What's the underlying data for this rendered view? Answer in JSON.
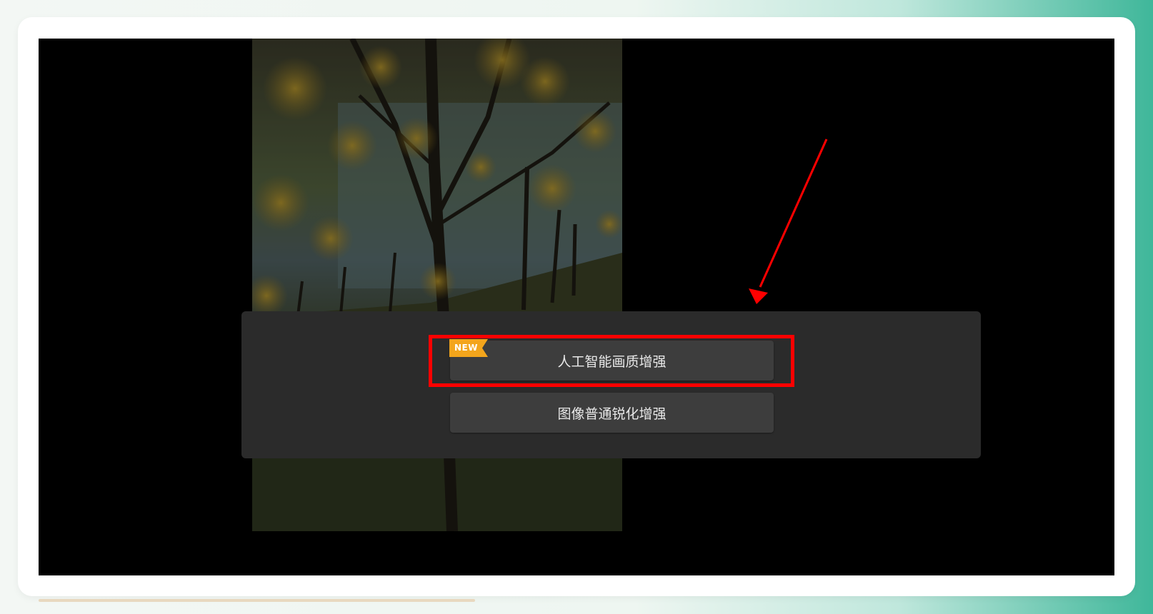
{
  "dialog": {
    "options": [
      {
        "label": "人工智能画质增强",
        "badge": "NEW"
      },
      {
        "label": "图像普通锐化增强"
      }
    ]
  },
  "colors": {
    "panel_bg": "#2b2b2b",
    "button_bg": "#3d3d3d",
    "badge": "#f3a51c",
    "annotation": "#ff0000"
  },
  "icons": {
    "annotation_arrow": "arrow-icon"
  }
}
